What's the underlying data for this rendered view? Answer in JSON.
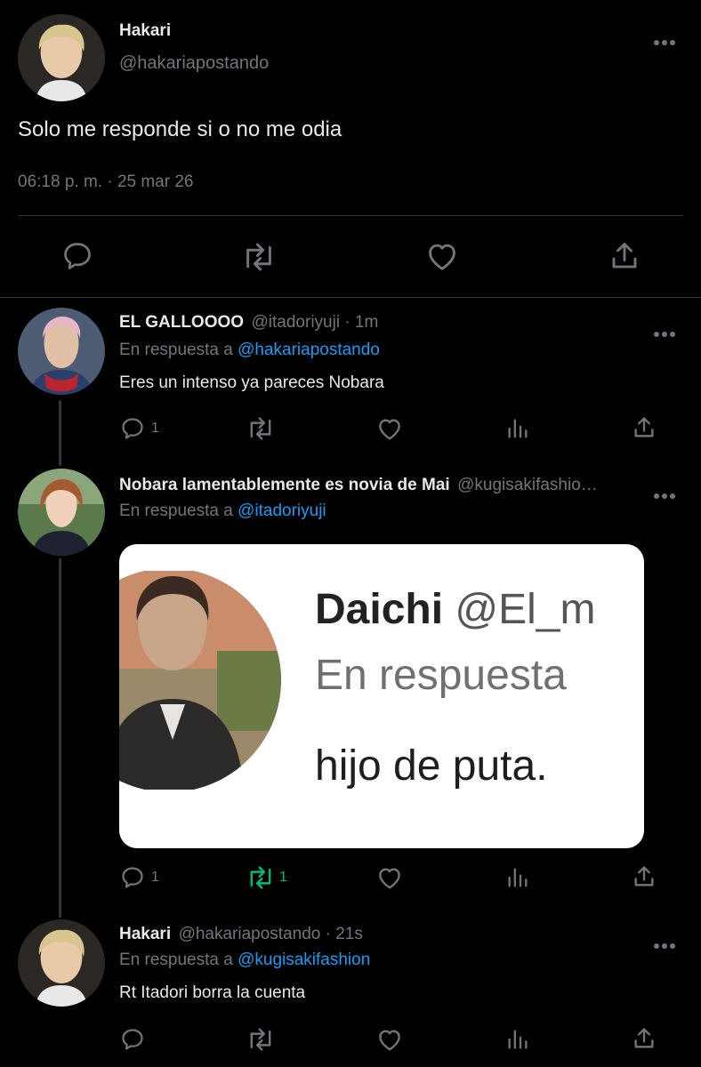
{
  "main_tweet": {
    "display_name": "Hakari",
    "handle": "@hakariapostando",
    "text": "Solo me responde si o no me odia",
    "timestamp": "06:18 p. m. · 25 mar 26"
  },
  "replies": [
    {
      "display_name": "EL GALLOOOO",
      "handle_time": "@itadoriyuji · 1m",
      "reply_prefix": "En respuesta a",
      "reply_to": "@hakariapostando",
      "text": "Eres un intenso ya pareces Nobara",
      "reply_count": "1",
      "retweet_count": ""
    },
    {
      "display_name": "Nobara lamentablemente es novia de Mai",
      "handle_time": "@kugisakifashio…",
      "reply_prefix": "En respuesta a",
      "reply_to": "@itadoriyuji",
      "media_text": {
        "name": "Daichi",
        "handle": "@El_m",
        "reply_line": "En respuesta",
        "body": "hijo de puta."
      },
      "reply_count": "1",
      "retweet_count": "1"
    },
    {
      "display_name": "Hakari",
      "handle_time": "@hakariapostando · 21s",
      "reply_prefix": "En respuesta a",
      "reply_to": "@kugisakifashion",
      "text": "Rt Itadori borra la cuenta",
      "reply_count": "",
      "retweet_count": ""
    }
  ],
  "colors": {
    "background": "#000000",
    "text": "#e7e9ea",
    "muted": "#71767b",
    "link": "#1d9bf0",
    "retweet_active": "#00ba7c"
  },
  "icons": [
    "more-icon",
    "reply-icon",
    "retweet-icon",
    "like-icon",
    "share-icon",
    "analytics-icon"
  ]
}
